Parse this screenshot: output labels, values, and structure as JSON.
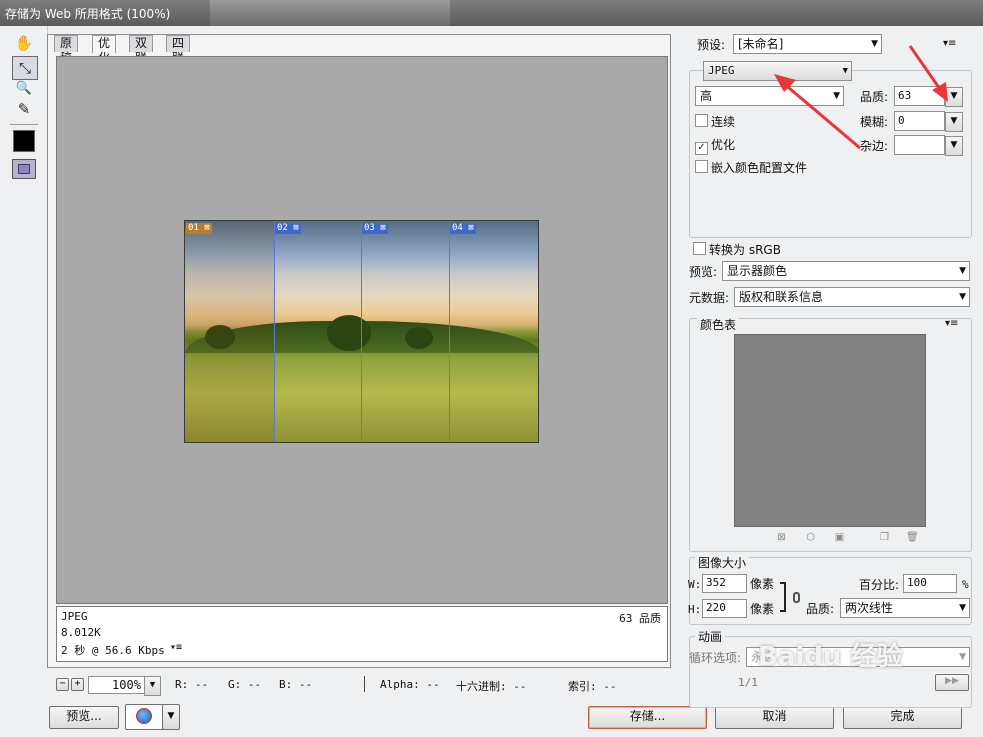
{
  "window": {
    "title": "存储为 Web 所用格式 (100%)"
  },
  "tools": [
    {
      "icon": "hand-icon",
      "glyph": "✋"
    },
    {
      "icon": "slice-select-icon",
      "glyph": "⤡"
    },
    {
      "icon": "zoom-icon",
      "glyph": "🔍"
    },
    {
      "icon": "eyedropper-icon",
      "glyph": "✎"
    }
  ],
  "tabs": [
    {
      "label": "原稿"
    },
    {
      "label": "优化"
    },
    {
      "label": "双联"
    },
    {
      "label": "四联"
    }
  ],
  "active_tab": "优化",
  "slices": [
    "01",
    "02",
    "03",
    "04"
  ],
  "info": {
    "format": "JPEG",
    "size": "8.012K",
    "time": "2 秒 @ 56.6 Kbps",
    "quality": "63 品质"
  },
  "zoom": {
    "value": "100%"
  },
  "readouts": {
    "r": "R: --",
    "g": "G: --",
    "b": "B: --",
    "alpha": "Alpha: --",
    "hex": "十六进制: --",
    "index": "索引: --"
  },
  "buttons": {
    "preview": "预览...",
    "save": "存储...",
    "cancel": "取消",
    "done": "完成"
  },
  "settings": {
    "preset_label": "预设:",
    "preset_value": "[未命名]",
    "format_value": "JPEG",
    "quality_level": "高",
    "quality_label": "品质:",
    "quality_value": "63",
    "progressive_label": "连续",
    "progressive_checked": false,
    "blur_label": "模糊:",
    "blur_value": "0",
    "optimized_label": "优化",
    "optimized_checked": true,
    "matte_label": "杂边:",
    "matte_value": "",
    "embed_profile_label": "嵌入颜色配置文件",
    "embed_profile_checked": false,
    "convert_srgb_label": "转换为 sRGB",
    "convert_srgb_checked": false,
    "preview_label": "预览:",
    "preview_value": "显示器颜色",
    "metadata_label": "元数据:",
    "metadata_value": "版权和联系信息"
  },
  "color_table": {
    "title": "颜色表"
  },
  "image_size": {
    "title": "图像大小",
    "w_label": "W:",
    "w_value": "352",
    "h_label": "H:",
    "h_value": "220",
    "unit": "像素",
    "percent_label": "百分比:",
    "percent_value": "100",
    "percent_unit": "%",
    "quality_label": "品质:",
    "quality_value": "两次线性"
  },
  "animation": {
    "title": "动画",
    "loop_label": "循环选项:",
    "loop_value": "永远",
    "frame": "1/1"
  },
  "colors": {
    "accent_arrow": "#e8363a",
    "save_focus": "#c0643a",
    "slice_line": "#5a79d9"
  },
  "watermark": "Baidu 经验"
}
